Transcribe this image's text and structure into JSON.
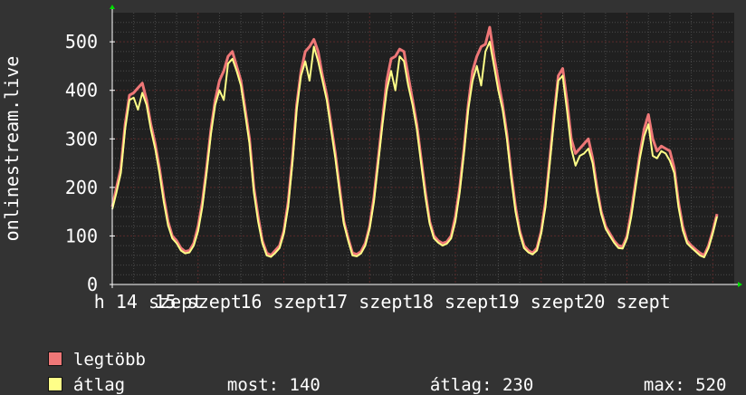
{
  "chart_data": {
    "type": "line",
    "ylabel": "onlinestream.live",
    "ylim": [
      0,
      560
    ],
    "y_ticks": [
      0,
      100,
      200,
      300,
      400,
      500
    ],
    "x_tick_labels": [
      "h 14 szept",
      "15 szept",
      "16 szept",
      "17 szept",
      "18 szept",
      "19 szept",
      "20 szept"
    ],
    "grid": true,
    "colors": {
      "background": "#333333",
      "plot_background": "#202020",
      "major_grid": "#5a2a2a",
      "minor_grid": "#4a4a4a",
      "axis_arrow": "#00dd00"
    },
    "days": 7.25,
    "series": [
      {
        "name": "legtöbb",
        "color": "#ee7777",
        "points": [
          [
            0.0,
            160
          ],
          [
            0.05,
            200
          ],
          [
            0.1,
            240
          ],
          [
            0.15,
            330
          ],
          [
            0.2,
            390
          ],
          [
            0.25,
            395
          ],
          [
            0.3,
            405
          ],
          [
            0.35,
            415
          ],
          [
            0.4,
            380
          ],
          [
            0.45,
            330
          ],
          [
            0.5,
            290
          ],
          [
            0.55,
            240
          ],
          [
            0.6,
            180
          ],
          [
            0.65,
            130
          ],
          [
            0.7,
            100
          ],
          [
            0.75,
            90
          ],
          [
            0.8,
            75
          ],
          [
            0.85,
            68
          ],
          [
            0.9,
            70
          ],
          [
            0.95,
            85
          ],
          [
            1.0,
            120
          ],
          [
            1.05,
            170
          ],
          [
            1.1,
            240
          ],
          [
            1.15,
            320
          ],
          [
            1.2,
            380
          ],
          [
            1.25,
            420
          ],
          [
            1.3,
            440
          ],
          [
            1.35,
            470
          ],
          [
            1.4,
            480
          ],
          [
            1.45,
            450
          ],
          [
            1.5,
            420
          ],
          [
            1.55,
            360
          ],
          [
            1.6,
            300
          ],
          [
            1.65,
            200
          ],
          [
            1.7,
            140
          ],
          [
            1.75,
            90
          ],
          [
            1.8,
            65
          ],
          [
            1.85,
            60
          ],
          [
            1.9,
            70
          ],
          [
            1.95,
            80
          ],
          [
            2.0,
            110
          ],
          [
            2.05,
            170
          ],
          [
            2.1,
            260
          ],
          [
            2.15,
            370
          ],
          [
            2.2,
            440
          ],
          [
            2.25,
            480
          ],
          [
            2.3,
            490
          ],
          [
            2.35,
            505
          ],
          [
            2.4,
            480
          ],
          [
            2.45,
            430
          ],
          [
            2.5,
            390
          ],
          [
            2.55,
            330
          ],
          [
            2.6,
            270
          ],
          [
            2.65,
            200
          ],
          [
            2.7,
            130
          ],
          [
            2.75,
            95
          ],
          [
            2.8,
            65
          ],
          [
            2.85,
            62
          ],
          [
            2.9,
            68
          ],
          [
            2.95,
            85
          ],
          [
            3.0,
            120
          ],
          [
            3.05,
            180
          ],
          [
            3.1,
            260
          ],
          [
            3.15,
            340
          ],
          [
            3.2,
            420
          ],
          [
            3.25,
            465
          ],
          [
            3.3,
            470
          ],
          [
            3.35,
            485
          ],
          [
            3.4,
            480
          ],
          [
            3.45,
            430
          ],
          [
            3.5,
            380
          ],
          [
            3.55,
            330
          ],
          [
            3.6,
            260
          ],
          [
            3.65,
            190
          ],
          [
            3.7,
            130
          ],
          [
            3.75,
            100
          ],
          [
            3.8,
            90
          ],
          [
            3.85,
            85
          ],
          [
            3.9,
            88
          ],
          [
            3.95,
            100
          ],
          [
            4.0,
            140
          ],
          [
            4.05,
            200
          ],
          [
            4.1,
            280
          ],
          [
            4.15,
            370
          ],
          [
            4.2,
            440
          ],
          [
            4.25,
            470
          ],
          [
            4.3,
            490
          ],
          [
            4.35,
            495
          ],
          [
            4.4,
            530
          ],
          [
            4.45,
            470
          ],
          [
            4.5,
            420
          ],
          [
            4.55,
            370
          ],
          [
            4.6,
            310
          ],
          [
            4.65,
            230
          ],
          [
            4.7,
            160
          ],
          [
            4.75,
            110
          ],
          [
            4.8,
            80
          ],
          [
            4.85,
            70
          ],
          [
            4.9,
            65
          ],
          [
            4.95,
            75
          ],
          [
            5.0,
            110
          ],
          [
            5.05,
            170
          ],
          [
            5.1,
            260
          ],
          [
            5.15,
            350
          ],
          [
            5.2,
            430
          ],
          [
            5.25,
            445
          ],
          [
            5.3,
            380
          ],
          [
            5.35,
            300
          ],
          [
            5.4,
            270
          ],
          [
            5.45,
            280
          ],
          [
            5.5,
            290
          ],
          [
            5.55,
            300
          ],
          [
            5.6,
            260
          ],
          [
            5.65,
            200
          ],
          [
            5.7,
            150
          ],
          [
            5.75,
            120
          ],
          [
            5.8,
            105
          ],
          [
            5.85,
            90
          ],
          [
            5.9,
            80
          ],
          [
            5.95,
            78
          ],
          [
            6.0,
            100
          ],
          [
            6.05,
            150
          ],
          [
            6.1,
            210
          ],
          [
            6.15,
            270
          ],
          [
            6.2,
            320
          ],
          [
            6.25,
            350
          ],
          [
            6.3,
            300
          ],
          [
            6.35,
            275
          ],
          [
            6.4,
            285
          ],
          [
            6.45,
            280
          ],
          [
            6.5,
            275
          ],
          [
            6.55,
            240
          ],
          [
            6.6,
            170
          ],
          [
            6.65,
            120
          ],
          [
            6.7,
            90
          ],
          [
            6.75,
            80
          ],
          [
            6.8,
            72
          ],
          [
            6.85,
            65
          ],
          [
            6.9,
            60
          ],
          [
            6.95,
            80
          ],
          [
            7.0,
            110
          ],
          [
            7.05,
            145
          ]
        ]
      },
      {
        "name": "átlag",
        "color": "#ffff88",
        "points": [
          [
            0.0,
            155
          ],
          [
            0.05,
            190
          ],
          [
            0.1,
            230
          ],
          [
            0.15,
            320
          ],
          [
            0.2,
            380
          ],
          [
            0.25,
            385
          ],
          [
            0.3,
            360
          ],
          [
            0.35,
            395
          ],
          [
            0.4,
            370
          ],
          [
            0.45,
            320
          ],
          [
            0.5,
            280
          ],
          [
            0.55,
            230
          ],
          [
            0.6,
            170
          ],
          [
            0.65,
            122
          ],
          [
            0.7,
            95
          ],
          [
            0.75,
            85
          ],
          [
            0.8,
            70
          ],
          [
            0.85,
            64
          ],
          [
            0.9,
            66
          ],
          [
            0.95,
            80
          ],
          [
            1.0,
            110
          ],
          [
            1.05,
            160
          ],
          [
            1.1,
            230
          ],
          [
            1.15,
            310
          ],
          [
            1.2,
            370
          ],
          [
            1.25,
            400
          ],
          [
            1.3,
            380
          ],
          [
            1.35,
            455
          ],
          [
            1.4,
            465
          ],
          [
            1.45,
            440
          ],
          [
            1.5,
            410
          ],
          [
            1.55,
            350
          ],
          [
            1.6,
            290
          ],
          [
            1.65,
            190
          ],
          [
            1.7,
            130
          ],
          [
            1.75,
            85
          ],
          [
            1.8,
            60
          ],
          [
            1.85,
            57
          ],
          [
            1.9,
            65
          ],
          [
            1.95,
            75
          ],
          [
            2.0,
            105
          ],
          [
            2.05,
            160
          ],
          [
            2.1,
            250
          ],
          [
            2.15,
            360
          ],
          [
            2.2,
            430
          ],
          [
            2.25,
            460
          ],
          [
            2.3,
            420
          ],
          [
            2.35,
            490
          ],
          [
            2.4,
            460
          ],
          [
            2.45,
            420
          ],
          [
            2.5,
            380
          ],
          [
            2.55,
            320
          ],
          [
            2.6,
            260
          ],
          [
            2.65,
            190
          ],
          [
            2.7,
            125
          ],
          [
            2.75,
            90
          ],
          [
            2.8,
            60
          ],
          [
            2.85,
            58
          ],
          [
            2.9,
            64
          ],
          [
            2.95,
            80
          ],
          [
            3.0,
            115
          ],
          [
            3.05,
            170
          ],
          [
            3.1,
            250
          ],
          [
            3.15,
            330
          ],
          [
            3.2,
            400
          ],
          [
            3.25,
            440
          ],
          [
            3.3,
            400
          ],
          [
            3.35,
            470
          ],
          [
            3.4,
            460
          ],
          [
            3.45,
            410
          ],
          [
            3.5,
            370
          ],
          [
            3.55,
            320
          ],
          [
            3.6,
            250
          ],
          [
            3.65,
            180
          ],
          [
            3.7,
            125
          ],
          [
            3.75,
            95
          ],
          [
            3.8,
            86
          ],
          [
            3.85,
            80
          ],
          [
            3.9,
            84
          ],
          [
            3.95,
            95
          ],
          [
            4.0,
            130
          ],
          [
            4.05,
            190
          ],
          [
            4.1,
            270
          ],
          [
            4.15,
            360
          ],
          [
            4.2,
            420
          ],
          [
            4.25,
            450
          ],
          [
            4.3,
            410
          ],
          [
            4.35,
            480
          ],
          [
            4.4,
            500
          ],
          [
            4.45,
            450
          ],
          [
            4.5,
            400
          ],
          [
            4.55,
            360
          ],
          [
            4.6,
            300
          ],
          [
            4.65,
            220
          ],
          [
            4.7,
            150
          ],
          [
            4.75,
            105
          ],
          [
            4.8,
            75
          ],
          [
            4.85,
            66
          ],
          [
            4.9,
            62
          ],
          [
            4.95,
            70
          ],
          [
            5.0,
            105
          ],
          [
            5.05,
            160
          ],
          [
            5.1,
            250
          ],
          [
            5.15,
            340
          ],
          [
            5.2,
            420
          ],
          [
            5.25,
            430
          ],
          [
            5.3,
            360
          ],
          [
            5.35,
            280
          ],
          [
            5.4,
            245
          ],
          [
            5.45,
            265
          ],
          [
            5.5,
            270
          ],
          [
            5.55,
            280
          ],
          [
            5.6,
            250
          ],
          [
            5.65,
            190
          ],
          [
            5.7,
            145
          ],
          [
            5.75,
            115
          ],
          [
            5.8,
            100
          ],
          [
            5.85,
            86
          ],
          [
            5.9,
            75
          ],
          [
            5.95,
            74
          ],
          [
            6.0,
            95
          ],
          [
            6.05,
            140
          ],
          [
            6.1,
            200
          ],
          [
            6.15,
            260
          ],
          [
            6.2,
            305
          ],
          [
            6.25,
            330
          ],
          [
            6.3,
            265
          ],
          [
            6.35,
            260
          ],
          [
            6.4,
            275
          ],
          [
            6.45,
            270
          ],
          [
            6.5,
            255
          ],
          [
            6.55,
            230
          ],
          [
            6.6,
            160
          ],
          [
            6.65,
            112
          ],
          [
            6.7,
            85
          ],
          [
            6.75,
            76
          ],
          [
            6.8,
            68
          ],
          [
            6.85,
            60
          ],
          [
            6.9,
            56
          ],
          [
            6.95,
            75
          ],
          [
            7.0,
            105
          ],
          [
            7.05,
            140
          ]
        ]
      }
    ]
  },
  "legend": {
    "items": [
      {
        "label": "legtöbb",
        "color": "#ee7777"
      },
      {
        "label": "átlag",
        "color": "#ffff88"
      }
    ],
    "stats": {
      "current_label": "most:",
      "current_value": "140",
      "average_label": "átlag:",
      "average_value": "230",
      "max_label": "max:",
      "max_value": "520"
    }
  }
}
